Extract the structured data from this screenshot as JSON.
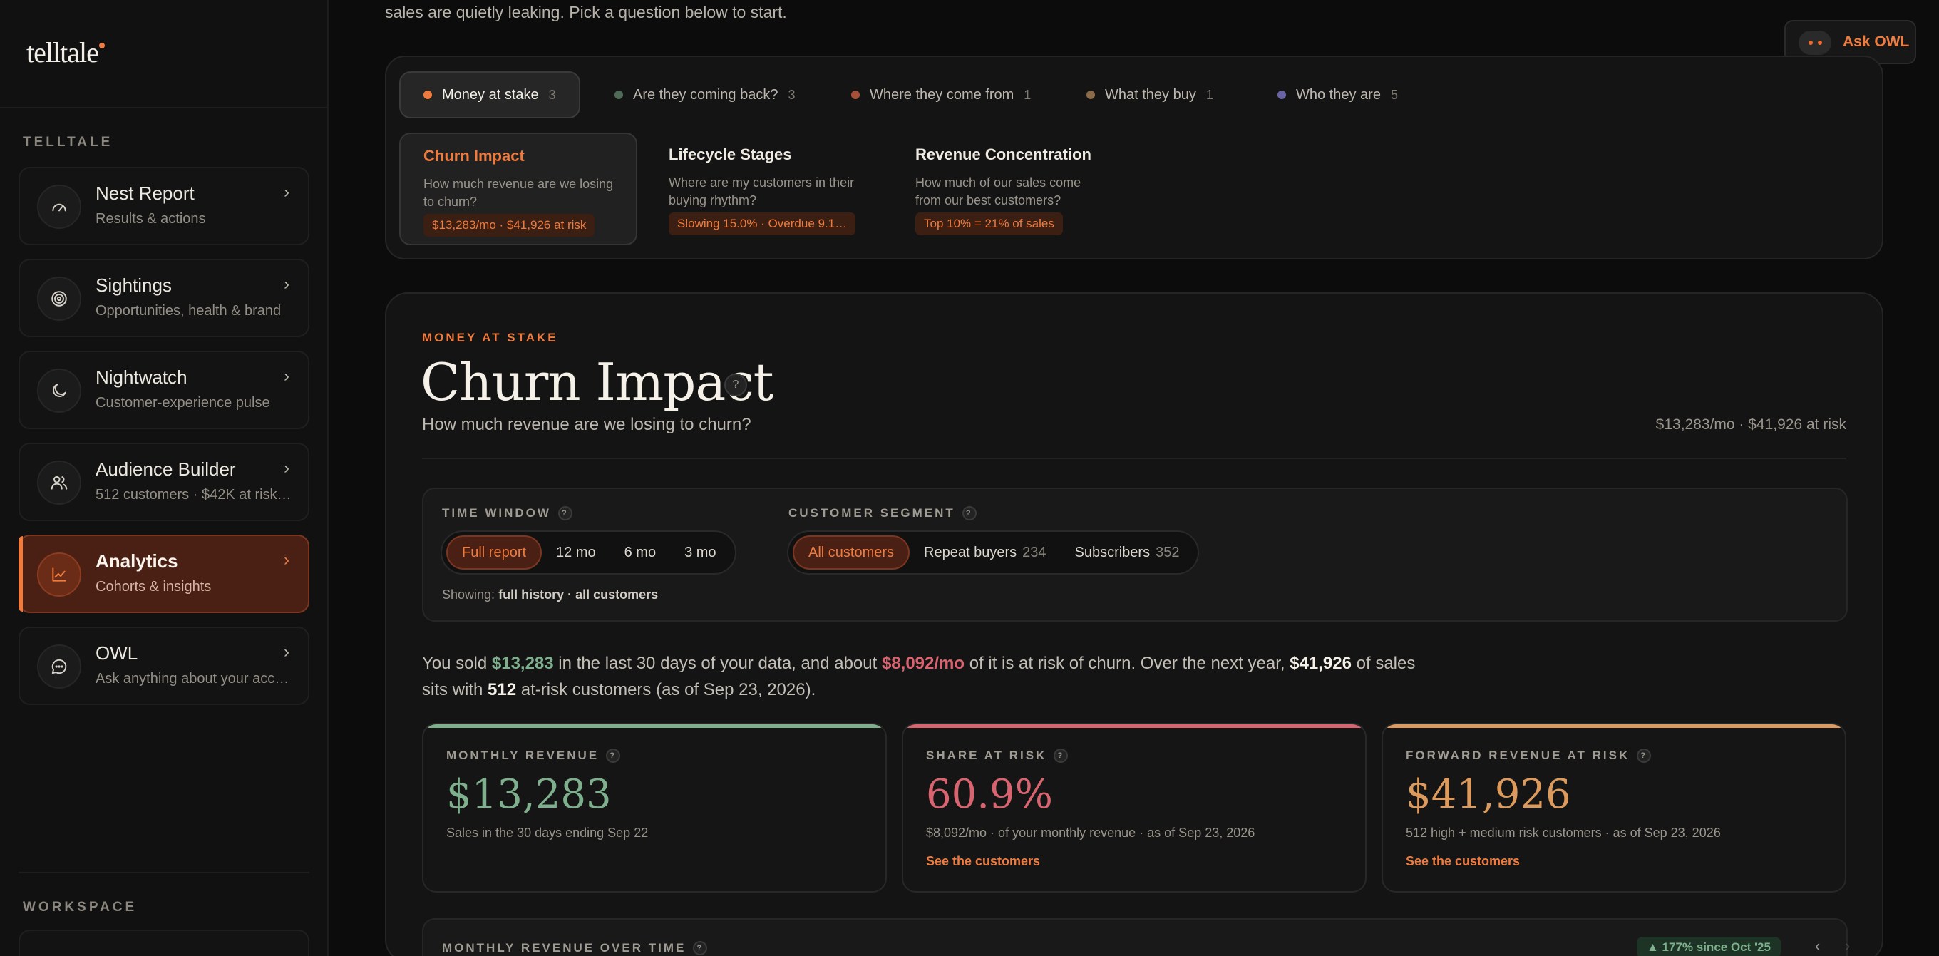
{
  "sidebar": {
    "brand": "telltale",
    "section_label": "TELLTALE",
    "workspace_label": "WORKSPACE",
    "items": [
      {
        "title": "Nest Report",
        "sub": "Results & actions",
        "icon": "gauge-icon"
      },
      {
        "title": "Sightings",
        "sub": "Opportunities, health & brand",
        "icon": "target-icon"
      },
      {
        "title": "Nightwatch",
        "sub": "Customer-experience pulse",
        "icon": "moon-icon"
      },
      {
        "title": "Audience Builder",
        "sub": "512 customers · $42K at risk…",
        "icon": "users-icon"
      },
      {
        "title": "Analytics",
        "sub": "Cohorts & insights",
        "icon": "chart-line-icon",
        "active": true
      },
      {
        "title": "OWL",
        "sub": "Ask anything about your acc…",
        "icon": "chat-bubble-icon"
      }
    ]
  },
  "header": {
    "intro_text": "sales are quietly leaking. Pick a question below to start.",
    "ask_owl": "Ask OWL"
  },
  "question_tabs": [
    {
      "label": "Money at stake",
      "count": "3",
      "color": "#ef7b3e",
      "active": true
    },
    {
      "label": "Are they coming back?",
      "count": "3",
      "color": "#4f6b58"
    },
    {
      "label": "Where they come from",
      "count": "1",
      "color": "#a6503a"
    },
    {
      "label": "What they buy",
      "count": "1",
      "color": "#8a6a48"
    },
    {
      "label": "Who they are",
      "count": "5",
      "color": "#6a63a3"
    }
  ],
  "metric_options": [
    {
      "title": "Churn Impact",
      "desc": "How much revenue are we losing to churn?",
      "pill": "$13,283/mo · $41,926 at risk",
      "active": true
    },
    {
      "title": "Lifecycle Stages",
      "desc": "Where are my customers in their buying rhythm?",
      "pill": "Slowing 15.0% · Overdue 9.1…"
    },
    {
      "title": "Revenue Concentration",
      "desc": "How much of our sales come from our best customers?",
      "pill": "Top 10% = 21% of sales"
    }
  ],
  "content": {
    "eyebrow": "MONEY AT STAKE",
    "title": "Churn Impact",
    "subtitle": "How much revenue are we losing to churn?",
    "right_meta": "$13,283/mo · $41,926 at risk",
    "help_glyph": "?"
  },
  "filters": {
    "time_window_label": "TIME WINDOW",
    "time_options": [
      "Full report",
      "12 mo",
      "6 mo",
      "3 mo"
    ],
    "time_selected": "Full report",
    "segment_label": "CUSTOMER SEGMENT",
    "segment_options": [
      {
        "label": "All customers",
        "count": ""
      },
      {
        "label": "Repeat buyers",
        "count": "234"
      },
      {
        "label": "Subscribers",
        "count": "352"
      }
    ],
    "segment_selected": "All customers",
    "showing_prefix": "Showing:",
    "showing_value": "full history · all customers"
  },
  "summary": {
    "p1": "You sold ",
    "sold": "$13,283",
    "p2": " in the last 30 days of your data, and about ",
    "risk_monthly": "$8,092/mo",
    "p3": " of it is at risk of churn. Over the next year, ",
    "forward": "$41,926",
    "p4": " of sales sits with ",
    "customers": "512",
    "p5": " at-risk customers (as of Sep 23, 2026)."
  },
  "kpis": [
    {
      "label": "MONTHLY REVENUE",
      "value": "$13,283",
      "note": "Sales in the 30 days ending Sep 22",
      "link": "",
      "color": "#7fb08e"
    },
    {
      "label": "SHARE AT RISK",
      "value": "60.9%",
      "note": "$8,092/mo · of your monthly revenue · as of Sep 23, 2026",
      "link": "See the customers",
      "color": "#d96470"
    },
    {
      "label": "FORWARD REVENUE AT RISK",
      "value": "$41,926",
      "note": "512 high + medium risk customers · as of Sep 23, 2026",
      "link": "See the customers",
      "color": "#dc9a5c"
    }
  ],
  "chart_panel": {
    "label": "MONTHLY REVENUE OVER TIME",
    "badge": "▲ 177% since Oct '25",
    "prev": "‹",
    "next": "›"
  }
}
